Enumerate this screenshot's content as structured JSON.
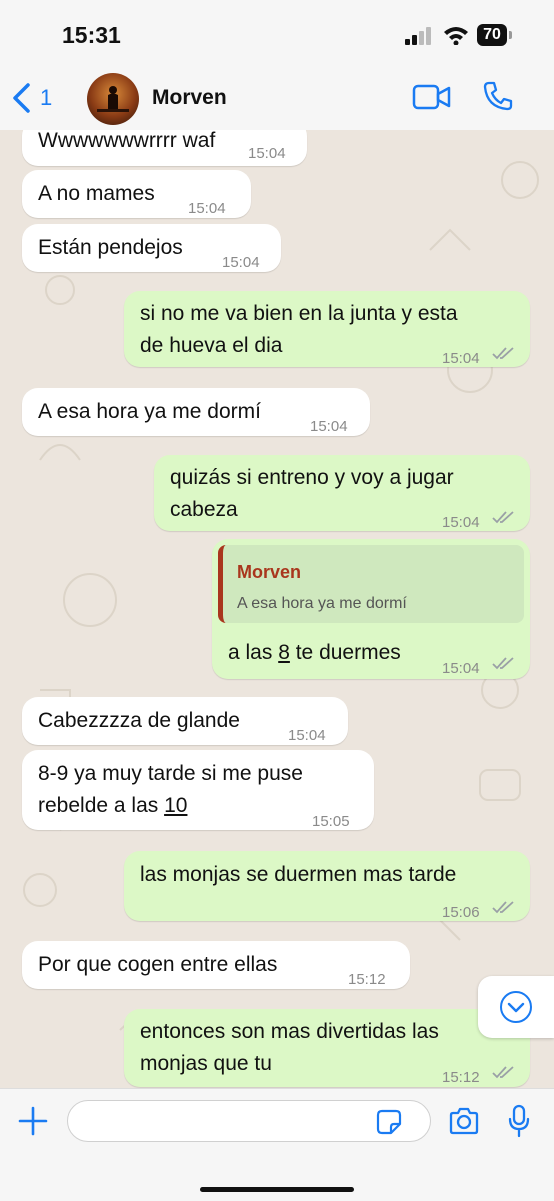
{
  "status_bar": {
    "time": "15:31",
    "battery": "70"
  },
  "header": {
    "back_count": "1",
    "contact_name": "Morven"
  },
  "messages": [
    {
      "dir": "in",
      "text": "Wwwwwwwrrrr waf",
      "time": "15:04"
    },
    {
      "dir": "in",
      "text": "A no mames",
      "time": "15:04"
    },
    {
      "dir": "in",
      "text": "Están pendejos",
      "time": "15:04"
    },
    {
      "dir": "out",
      "lines": [
        "si no me va bien en la junta y esta",
        "de hueva el dia"
      ],
      "time": "15:04"
    },
    {
      "dir": "in",
      "text": "A esa hora ya me dormí",
      "time": "15:04"
    },
    {
      "dir": "out",
      "lines": [
        "quizás si entreno y voy a jugar",
        "cabeza"
      ],
      "time": "15:04"
    },
    {
      "dir": "out",
      "quote": {
        "name": "Morven",
        "text": "A esa hora ya me dormí"
      },
      "text_before": "a las ",
      "link": "8",
      "text_after": " te duermes",
      "time": "15:04"
    },
    {
      "dir": "in",
      "text": "Cabezzzza de glande",
      "time": "15:04"
    },
    {
      "dir": "in",
      "line1": "8-9 ya muy tarde si me puse",
      "line2_before": "rebelde a las ",
      "line2_link": "10",
      "time": "15:05"
    },
    {
      "dir": "out",
      "text": "las monjas se duermen mas tarde",
      "time": "15:06"
    },
    {
      "dir": "in",
      "text": "Por que cogen entre ellas",
      "time": "15:12"
    },
    {
      "dir": "out",
      "lines": [
        "entonces son mas divertidas las",
        "monjas que tu"
      ],
      "time": "15:12"
    }
  ],
  "composer": {
    "placeholder": ""
  }
}
